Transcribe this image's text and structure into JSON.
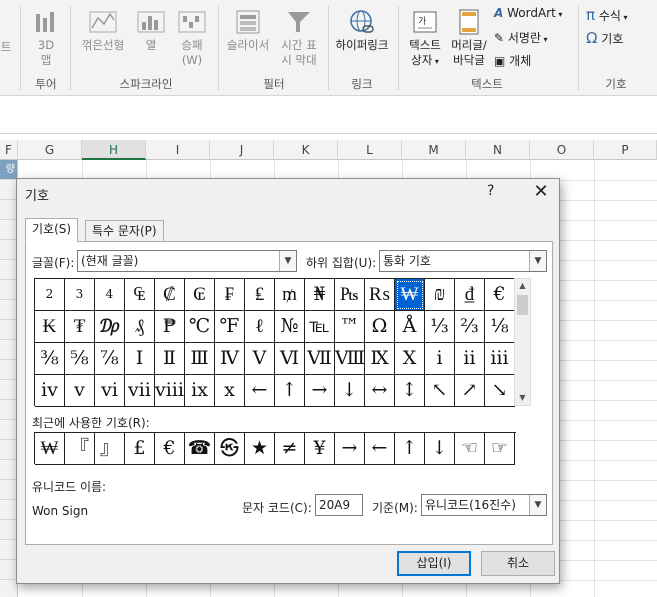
{
  "ribbon": {
    "left_clip": {
      "line1": "트",
      "line2": "",
      "group": "ᘎ"
    },
    "chart3d": {
      "line1": "3D",
      "line2": "맵",
      "group": "투어"
    },
    "spark_line": "꺾은선형",
    "spark_col": "열",
    "spark_win": "승패",
    "spark_win2": "(W)",
    "spark_group": "스파크라인",
    "slicer": "슬라이서",
    "timeline": "시간 표",
    "timeline2": "시 막대",
    "filter_group": "필터",
    "hyperlink": "하이퍼링크",
    "link_group": "링크",
    "textbox": "텍스트",
    "textbox2": "상자",
    "header": "머리글/",
    "header2": "바닥글",
    "wordart": "WordArt",
    "signature": "서명란",
    "object": "개체",
    "text_group": "텍스트",
    "equation": "수식",
    "symbol": "기호",
    "symbol_group": "기호"
  },
  "sheet": {
    "columns": [
      "F",
      "G",
      "H",
      "I",
      "J",
      "K",
      "L",
      "M",
      "N",
      "O",
      "P"
    ],
    "selected_column": "H",
    "row_head_clip": "량"
  },
  "dialog": {
    "title": "기호",
    "help": "?",
    "close": "✕",
    "tabs": [
      "기호(S)",
      "특수 문자(P)"
    ],
    "font_label": "글꼴(F):",
    "font_value": "(현재 글꼴)",
    "subset_label": "하위 집합(U):",
    "subset_value": "통화 기호",
    "symbols": [
      "2",
      "3",
      "4",
      "₠",
      "₡",
      "₢",
      "₣",
      "₤",
      "₥",
      "₦",
      "₧",
      "₨",
      "₩",
      "₪",
      "₫",
      "€",
      "₭",
      "₮",
      "₯",
      "₰",
      "₱",
      "℃",
      "℉",
      "ℓ",
      "№",
      "℡",
      "™",
      "Ω",
      "Å",
      "⅓",
      "⅔",
      "⅛",
      "⅜",
      "⅝",
      "⅞",
      "Ⅰ",
      "Ⅱ",
      "Ⅲ",
      "Ⅳ",
      "Ⅴ",
      "Ⅵ",
      "Ⅶ",
      "Ⅷ",
      "Ⅸ",
      "Ⅹ",
      "ⅰ",
      "ⅱ",
      "ⅲ",
      "ⅳ",
      "ⅴ",
      "ⅵ",
      "ⅶ",
      "ⅷ",
      "ⅸ",
      "ⅹ",
      "←",
      "↑",
      "→",
      "↓",
      "↔",
      "↕",
      "↖",
      "↗",
      "↘"
    ],
    "selected_symbol": "₩",
    "recent_label": "최근에 사용한 기호(R):",
    "recent": [
      "₩",
      "『",
      "』",
      "£",
      "€",
      "☎",
      "㉿",
      "★",
      "≠",
      "¥",
      "→",
      "←",
      "↑",
      "↓",
      "☜",
      "☞"
    ],
    "unicode_name_label": "유니코드 이름:",
    "unicode_name": "Won Sign",
    "charcode_label": "문자 코드(C):",
    "charcode": "20A9",
    "from_label": "기준(M):",
    "from_value": "유니코드(16진수)",
    "insert": "삽입(I)",
    "cancel": "취소"
  }
}
